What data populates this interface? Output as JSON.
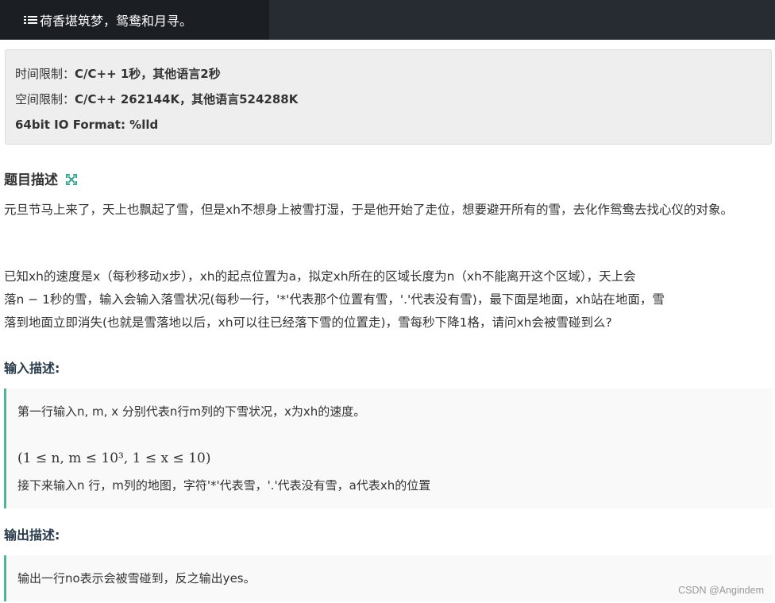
{
  "header": {
    "title": "荷香堪筑梦，鸳鸯和月寻。",
    "icon": "list-icon"
  },
  "limits": {
    "time_label": "时间限制：",
    "time_value": "C/C++ 1秒，其他语言2秒",
    "space_label": "空间限制：",
    "space_value": "C/C++ 262144K，其他语言524288K",
    "format": "64bit IO Format: %lld"
  },
  "description": {
    "heading": "题目描述",
    "icon": "expand-icon",
    "p1": "元旦节马上来了，天上也飘起了雪，但是xh不想身上被雪打湿，于是他开始了走位，想要避开所有的雪，去化作鸳鸯去找心仪的对象。",
    "p2_line1": "已知xh的速度是x（每秒移动x步），xh的起点位置为a，拟定xh所在的区域长度为n（xh不能离开这个区域），天上会",
    "p2_line2": "落n − 1秒的雪，输入会输入落雪状况(每秒一行，'*'代表那个位置有雪，'.'代表没有雪)，最下面是地面，xh站在地面，雪",
    "p2_line3": "落到地面立即消失(也就是雪落地以后，xh可以往已经落下雪的位置走)，雪每秒下降1格，请问xh会被雪碰到么?"
  },
  "input": {
    "heading": "输入描述:",
    "line1": "第一行输入n, m, x  分别代表n行m列的下雪状况，x为xh的速度。",
    "line2": "(1 ≤ n, m ≤ 10³, 1 ≤ x ≤ 10)",
    "line3": "接下来输入n  行，m列的地图，字符'*'代表雪，'.'代表没有雪，a代表xh的位置"
  },
  "output": {
    "heading": "输出描述:",
    "line1": "输出一行no表示会被雪碰到，反之输出yes。"
  },
  "watermark": "CSDN @Angindem",
  "colors": {
    "topbar": "#272c33",
    "title_box": "#1b1f24",
    "accent": "#4cb69c",
    "limits_bg": "#eeeeee"
  }
}
